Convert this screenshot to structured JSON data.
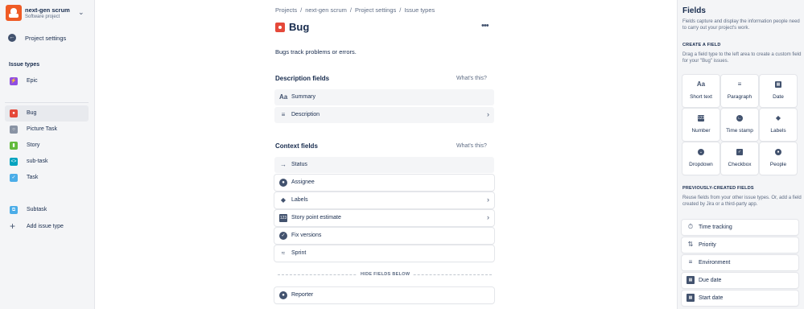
{
  "project": {
    "name": "next-gen scrum",
    "type": "Software project"
  },
  "sidebar": {
    "back_label": "Project settings",
    "section_heading": "Issue types",
    "items": [
      {
        "label": "Epic",
        "color": "#904ee2"
      },
      {
        "label": "Bug",
        "color": "#e5493a"
      },
      {
        "label": "Picture Task",
        "color": "#8993a4"
      },
      {
        "label": "Story",
        "color": "#63ba3c"
      },
      {
        "label": "sub-task",
        "color": "#00a3bf"
      },
      {
        "label": "Task",
        "color": "#4bade8"
      },
      {
        "label": "Subtask",
        "color": "#4bade8"
      }
    ],
    "add_label": "Add issue type"
  },
  "breadcrumbs": [
    "Projects",
    "next-gen scrum",
    "Project settings",
    "Issue types"
  ],
  "page": {
    "title": "Bug",
    "more_label": "•••",
    "description": "Bugs track problems or errors."
  },
  "description_fields": {
    "title": "Description fields",
    "help": "What's this?",
    "fields": [
      {
        "label": "Summary",
        "icon": "text-icon"
      },
      {
        "label": "Description",
        "icon": "paragraph-icon"
      }
    ]
  },
  "context_fields": {
    "title": "Context fields",
    "help": "What's this?",
    "fields": [
      {
        "label": "Status",
        "icon": "arrow-right-icon"
      },
      {
        "label": "Assignee",
        "icon": "person-icon"
      },
      {
        "label": "Labels",
        "icon": "tag-icon"
      },
      {
        "label": "Story point estimate",
        "icon": "number-icon"
      },
      {
        "label": "Fix versions",
        "icon": "ship-icon"
      },
      {
        "label": "Sprint",
        "icon": "sprint-icon"
      }
    ],
    "hide_label": "HIDE FIELDS BELOW",
    "hidden_fields": [
      {
        "label": "Reporter",
        "icon": "person-icon"
      }
    ]
  },
  "panel": {
    "title": "Fields",
    "description": "Fields capture and display the information people need to carry out your project's work.",
    "create_heading": "CREATE A FIELD",
    "create_note": "Drag a field type to the left area to create a custom field for your \"Bug\" issues.",
    "field_types": [
      {
        "label": "Short text",
        "icon": "text-icon"
      },
      {
        "label": "Paragraph",
        "icon": "paragraph-icon"
      },
      {
        "label": "Date",
        "icon": "calendar-icon"
      },
      {
        "label": "Number",
        "icon": "number-icon"
      },
      {
        "label": "Time stamp",
        "icon": "clock-icon"
      },
      {
        "label": "Labels",
        "icon": "tag-icon"
      },
      {
        "label": "Dropdown",
        "icon": "dropdown-icon"
      },
      {
        "label": "Checkbox",
        "icon": "checkbox-icon"
      },
      {
        "label": "People",
        "icon": "person-icon"
      }
    ],
    "prev_heading": "PREVIOUSLY-CREATED FIELDS",
    "prev_note": "Reuse fields from your other issue types. Or, add a field created by Jira or a third-party app.",
    "previous_fields": [
      {
        "label": "Time tracking",
        "icon": "stopwatch-icon"
      },
      {
        "label": "Priority",
        "icon": "priority-icon"
      },
      {
        "label": "Environment",
        "icon": "paragraph-icon"
      },
      {
        "label": "Due date",
        "icon": "calendar-icon"
      },
      {
        "label": "Start date",
        "icon": "calendar-icon"
      }
    ]
  }
}
